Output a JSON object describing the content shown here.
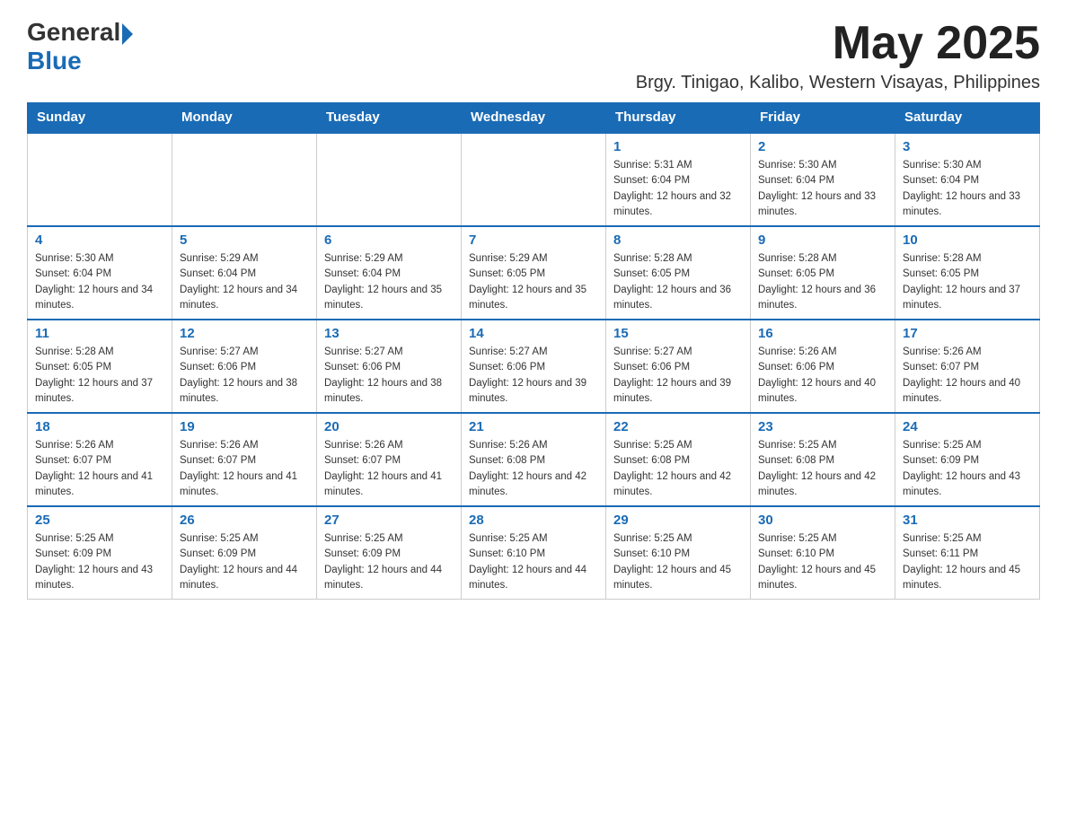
{
  "header": {
    "logo": {
      "general": "General",
      "blue": "Blue"
    },
    "month_year": "May 2025",
    "subtitle": "Brgy. Tinigao, Kalibo, Western Visayas, Philippines"
  },
  "calendar": {
    "days_of_week": [
      "Sunday",
      "Monday",
      "Tuesday",
      "Wednesday",
      "Thursday",
      "Friday",
      "Saturday"
    ],
    "weeks": [
      [
        {
          "day": "",
          "info": ""
        },
        {
          "day": "",
          "info": ""
        },
        {
          "day": "",
          "info": ""
        },
        {
          "day": "",
          "info": ""
        },
        {
          "day": "1",
          "info": "Sunrise: 5:31 AM\nSunset: 6:04 PM\nDaylight: 12 hours and 32 minutes."
        },
        {
          "day": "2",
          "info": "Sunrise: 5:30 AM\nSunset: 6:04 PM\nDaylight: 12 hours and 33 minutes."
        },
        {
          "day": "3",
          "info": "Sunrise: 5:30 AM\nSunset: 6:04 PM\nDaylight: 12 hours and 33 minutes."
        }
      ],
      [
        {
          "day": "4",
          "info": "Sunrise: 5:30 AM\nSunset: 6:04 PM\nDaylight: 12 hours and 34 minutes."
        },
        {
          "day": "5",
          "info": "Sunrise: 5:29 AM\nSunset: 6:04 PM\nDaylight: 12 hours and 34 minutes."
        },
        {
          "day": "6",
          "info": "Sunrise: 5:29 AM\nSunset: 6:04 PM\nDaylight: 12 hours and 35 minutes."
        },
        {
          "day": "7",
          "info": "Sunrise: 5:29 AM\nSunset: 6:05 PM\nDaylight: 12 hours and 35 minutes."
        },
        {
          "day": "8",
          "info": "Sunrise: 5:28 AM\nSunset: 6:05 PM\nDaylight: 12 hours and 36 minutes."
        },
        {
          "day": "9",
          "info": "Sunrise: 5:28 AM\nSunset: 6:05 PM\nDaylight: 12 hours and 36 minutes."
        },
        {
          "day": "10",
          "info": "Sunrise: 5:28 AM\nSunset: 6:05 PM\nDaylight: 12 hours and 37 minutes."
        }
      ],
      [
        {
          "day": "11",
          "info": "Sunrise: 5:28 AM\nSunset: 6:05 PM\nDaylight: 12 hours and 37 minutes."
        },
        {
          "day": "12",
          "info": "Sunrise: 5:27 AM\nSunset: 6:06 PM\nDaylight: 12 hours and 38 minutes."
        },
        {
          "day": "13",
          "info": "Sunrise: 5:27 AM\nSunset: 6:06 PM\nDaylight: 12 hours and 38 minutes."
        },
        {
          "day": "14",
          "info": "Sunrise: 5:27 AM\nSunset: 6:06 PM\nDaylight: 12 hours and 39 minutes."
        },
        {
          "day": "15",
          "info": "Sunrise: 5:27 AM\nSunset: 6:06 PM\nDaylight: 12 hours and 39 minutes."
        },
        {
          "day": "16",
          "info": "Sunrise: 5:26 AM\nSunset: 6:06 PM\nDaylight: 12 hours and 40 minutes."
        },
        {
          "day": "17",
          "info": "Sunrise: 5:26 AM\nSunset: 6:07 PM\nDaylight: 12 hours and 40 minutes."
        }
      ],
      [
        {
          "day": "18",
          "info": "Sunrise: 5:26 AM\nSunset: 6:07 PM\nDaylight: 12 hours and 41 minutes."
        },
        {
          "day": "19",
          "info": "Sunrise: 5:26 AM\nSunset: 6:07 PM\nDaylight: 12 hours and 41 minutes."
        },
        {
          "day": "20",
          "info": "Sunrise: 5:26 AM\nSunset: 6:07 PM\nDaylight: 12 hours and 41 minutes."
        },
        {
          "day": "21",
          "info": "Sunrise: 5:26 AM\nSunset: 6:08 PM\nDaylight: 12 hours and 42 minutes."
        },
        {
          "day": "22",
          "info": "Sunrise: 5:25 AM\nSunset: 6:08 PM\nDaylight: 12 hours and 42 minutes."
        },
        {
          "day": "23",
          "info": "Sunrise: 5:25 AM\nSunset: 6:08 PM\nDaylight: 12 hours and 42 minutes."
        },
        {
          "day": "24",
          "info": "Sunrise: 5:25 AM\nSunset: 6:09 PM\nDaylight: 12 hours and 43 minutes."
        }
      ],
      [
        {
          "day": "25",
          "info": "Sunrise: 5:25 AM\nSunset: 6:09 PM\nDaylight: 12 hours and 43 minutes."
        },
        {
          "day": "26",
          "info": "Sunrise: 5:25 AM\nSunset: 6:09 PM\nDaylight: 12 hours and 44 minutes."
        },
        {
          "day": "27",
          "info": "Sunrise: 5:25 AM\nSunset: 6:09 PM\nDaylight: 12 hours and 44 minutes."
        },
        {
          "day": "28",
          "info": "Sunrise: 5:25 AM\nSunset: 6:10 PM\nDaylight: 12 hours and 44 minutes."
        },
        {
          "day": "29",
          "info": "Sunrise: 5:25 AM\nSunset: 6:10 PM\nDaylight: 12 hours and 45 minutes."
        },
        {
          "day": "30",
          "info": "Sunrise: 5:25 AM\nSunset: 6:10 PM\nDaylight: 12 hours and 45 minutes."
        },
        {
          "day": "31",
          "info": "Sunrise: 5:25 AM\nSunset: 6:11 PM\nDaylight: 12 hours and 45 minutes."
        }
      ]
    ]
  }
}
